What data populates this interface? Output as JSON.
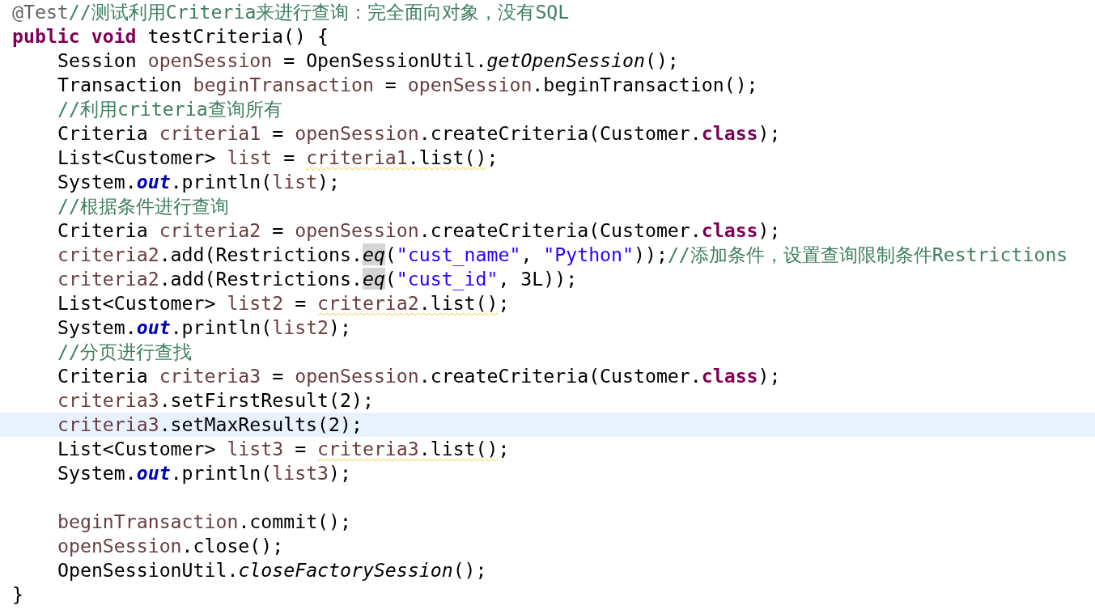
{
  "lines": [
    {
      "current": false,
      "indented": false,
      "tokens": [
        {
          "kind": "annotation",
          "text": "@Test"
        },
        {
          "kind": "comment",
          "text": "//测试利用Criteria来进行查询：完全面向对象，没有SQL"
        }
      ]
    },
    {
      "current": false,
      "indented": false,
      "tokens": [
        {
          "kind": "keyword",
          "text": "public void"
        },
        {
          "kind": "plain",
          "text": " testCriteria() {"
        }
      ]
    },
    {
      "current": false,
      "indented": true,
      "tokens": [
        {
          "kind": "plain",
          "text": "Session "
        },
        {
          "kind": "variable",
          "text": "openSession"
        },
        {
          "kind": "plain",
          "text": " = OpenSessionUtil."
        },
        {
          "kind": "static_method",
          "text": "getOpenSession"
        },
        {
          "kind": "plain",
          "text": "();"
        }
      ]
    },
    {
      "current": false,
      "indented": true,
      "tokens": [
        {
          "kind": "plain",
          "text": "Transaction "
        },
        {
          "kind": "variable",
          "text": "beginTransaction"
        },
        {
          "kind": "plain",
          "text": " = "
        },
        {
          "kind": "variable",
          "text": "openSession"
        },
        {
          "kind": "plain",
          "text": ".beginTransaction();"
        }
      ]
    },
    {
      "current": false,
      "indented": true,
      "tokens": [
        {
          "kind": "comment",
          "text": "//利用criteria查询所有"
        }
      ]
    },
    {
      "current": false,
      "indented": true,
      "tokens": [
        {
          "kind": "plain",
          "text": "Criteria "
        },
        {
          "kind": "variable",
          "text": "criteria1"
        },
        {
          "kind": "plain",
          "text": " = "
        },
        {
          "kind": "variable",
          "text": "openSession"
        },
        {
          "kind": "plain",
          "text": ".createCriteria(Customer."
        },
        {
          "kind": "keyword",
          "text": "class"
        },
        {
          "kind": "plain",
          "text": ");"
        }
      ]
    },
    {
      "current": false,
      "indented": true,
      "tokens": [
        {
          "kind": "plain",
          "text": "List<Customer> "
        },
        {
          "kind": "variable",
          "text": "list"
        },
        {
          "kind": "plain",
          "text": " = "
        },
        {
          "kind": "variable",
          "text": "criteria1",
          "warning": true
        },
        {
          "kind": "plain",
          "text": ".list()",
          "warning": true
        },
        {
          "kind": "plain",
          "text": ";"
        }
      ]
    },
    {
      "current": false,
      "indented": true,
      "tokens": [
        {
          "kind": "plain",
          "text": "System."
        },
        {
          "kind": "static_field",
          "text": "out"
        },
        {
          "kind": "plain",
          "text": ".println("
        },
        {
          "kind": "variable",
          "text": "list"
        },
        {
          "kind": "plain",
          "text": ");"
        }
      ]
    },
    {
      "current": false,
      "indented": true,
      "tokens": [
        {
          "kind": "comment",
          "text": "//根据条件进行查询"
        }
      ]
    },
    {
      "current": false,
      "indented": true,
      "tokens": [
        {
          "kind": "plain",
          "text": "Criteria "
        },
        {
          "kind": "variable",
          "text": "criteria2"
        },
        {
          "kind": "plain",
          "text": " = "
        },
        {
          "kind": "variable",
          "text": "openSession"
        },
        {
          "kind": "plain",
          "text": ".createCriteria(Customer."
        },
        {
          "kind": "keyword",
          "text": "class"
        },
        {
          "kind": "plain",
          "text": ");"
        }
      ]
    },
    {
      "current": false,
      "indented": true,
      "tokens": [
        {
          "kind": "variable",
          "text": "criteria2"
        },
        {
          "kind": "plain",
          "text": ".add(Restrictions."
        },
        {
          "kind": "static_method",
          "text": "eq",
          "highlighted": true
        },
        {
          "kind": "plain",
          "text": "("
        },
        {
          "kind": "string",
          "text": "\"cust_name\""
        },
        {
          "kind": "plain",
          "text": ", "
        },
        {
          "kind": "string",
          "text": "\"Python\""
        },
        {
          "kind": "plain",
          "text": "));"
        },
        {
          "kind": "comment",
          "text": "//添加条件，设置查询限制条件Restrictions"
        }
      ]
    },
    {
      "current": false,
      "indented": true,
      "tokens": [
        {
          "kind": "variable",
          "text": "criteria2"
        },
        {
          "kind": "plain",
          "text": ".add(Restrictions."
        },
        {
          "kind": "static_method",
          "text": "eq",
          "highlighted": true
        },
        {
          "kind": "plain",
          "text": "("
        },
        {
          "kind": "string",
          "text": "\"cust_id\""
        },
        {
          "kind": "plain",
          "text": ", 3L));"
        }
      ]
    },
    {
      "current": false,
      "indented": true,
      "tokens": [
        {
          "kind": "plain",
          "text": "List<Customer> "
        },
        {
          "kind": "variable",
          "text": "list2"
        },
        {
          "kind": "plain",
          "text": " = "
        },
        {
          "kind": "variable",
          "text": "criteria2",
          "warning": true
        },
        {
          "kind": "plain",
          "text": ".list()",
          "warning": true
        },
        {
          "kind": "plain",
          "text": ";"
        }
      ]
    },
    {
      "current": false,
      "indented": true,
      "tokens": [
        {
          "kind": "plain",
          "text": "System."
        },
        {
          "kind": "static_field",
          "text": "out"
        },
        {
          "kind": "plain",
          "text": ".println("
        },
        {
          "kind": "variable",
          "text": "list2"
        },
        {
          "kind": "plain",
          "text": ");"
        }
      ]
    },
    {
      "current": false,
      "indented": true,
      "tokens": [
        {
          "kind": "comment",
          "text": "//分页进行查找"
        }
      ]
    },
    {
      "current": false,
      "indented": true,
      "tokens": [
        {
          "kind": "plain",
          "text": "Criteria "
        },
        {
          "kind": "variable",
          "text": "criteria3"
        },
        {
          "kind": "plain",
          "text": " = "
        },
        {
          "kind": "variable",
          "text": "openSession"
        },
        {
          "kind": "plain",
          "text": ".createCriteria(Customer."
        },
        {
          "kind": "keyword",
          "text": "class"
        },
        {
          "kind": "plain",
          "text": ");"
        }
      ]
    },
    {
      "current": false,
      "indented": true,
      "tokens": [
        {
          "kind": "variable",
          "text": "criteria3"
        },
        {
          "kind": "plain",
          "text": ".setFirstResult(2);"
        }
      ]
    },
    {
      "current": true,
      "indented": true,
      "tokens": [
        {
          "kind": "variable",
          "text": "criteria3"
        },
        {
          "kind": "plain",
          "text": ".setMaxResults(2);"
        }
      ]
    },
    {
      "current": false,
      "indented": true,
      "tokens": [
        {
          "kind": "plain",
          "text": "List<Customer> "
        },
        {
          "kind": "variable",
          "text": "list3"
        },
        {
          "kind": "plain",
          "text": " = "
        },
        {
          "kind": "variable",
          "text": "criteria3",
          "warning": true
        },
        {
          "kind": "plain",
          "text": ".list()",
          "warning": true
        },
        {
          "kind": "plain",
          "text": ";"
        }
      ]
    },
    {
      "current": false,
      "indented": true,
      "tokens": [
        {
          "kind": "plain",
          "text": "System."
        },
        {
          "kind": "static_field",
          "text": "out"
        },
        {
          "kind": "plain",
          "text": ".println("
        },
        {
          "kind": "variable",
          "text": "list3"
        },
        {
          "kind": "plain",
          "text": ");"
        }
      ]
    },
    {
      "current": false
    },
    {
      "current": false,
      "indented": true,
      "tokens": [
        {
          "kind": "variable",
          "text": "beginTransaction"
        },
        {
          "kind": "plain",
          "text": ".commit();"
        }
      ]
    },
    {
      "current": false,
      "indented": true,
      "tokens": [
        {
          "kind": "variable",
          "text": "openSession"
        },
        {
          "kind": "plain",
          "text": ".close();"
        }
      ]
    },
    {
      "current": false,
      "indented": true,
      "tokens": [
        {
          "kind": "plain",
          "text": "OpenSessionUtil."
        },
        {
          "kind": "static_method",
          "text": "closeFactorySession"
        },
        {
          "kind": "plain",
          "text": "();"
        }
      ]
    },
    {
      "current": false,
      "indented": false,
      "tokens": [
        {
          "kind": "plain",
          "text": "}"
        }
      ]
    }
  ]
}
